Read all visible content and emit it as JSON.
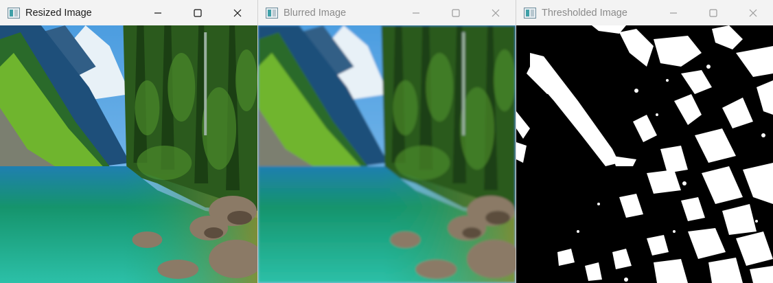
{
  "windows": [
    {
      "title": "Resized Image",
      "state": "active",
      "icon": "app-image-icon",
      "content": "landscape-photo"
    },
    {
      "title": "Blurred Image",
      "state": "inactive",
      "icon": "app-image-icon",
      "content": "landscape-photo-blurred"
    },
    {
      "title": "Thresholded Image",
      "state": "inactive",
      "icon": "app-image-icon",
      "content": "binary-threshold-image"
    }
  ],
  "caption_buttons": [
    "minimize-icon",
    "maximize-icon",
    "close-icon"
  ],
  "colors": {
    "titlebar_bg": "#f3f3f3",
    "active_title": "#1a1a1a",
    "inactive_title": "#8a8a8a",
    "sky": "#3c8fd6",
    "forest": "#2f6a1c",
    "grass": "#5fae2a",
    "water": "#1aa06e",
    "rock": "#8b7a66",
    "threshold_black": "#000000",
    "threshold_white": "#ffffff"
  }
}
